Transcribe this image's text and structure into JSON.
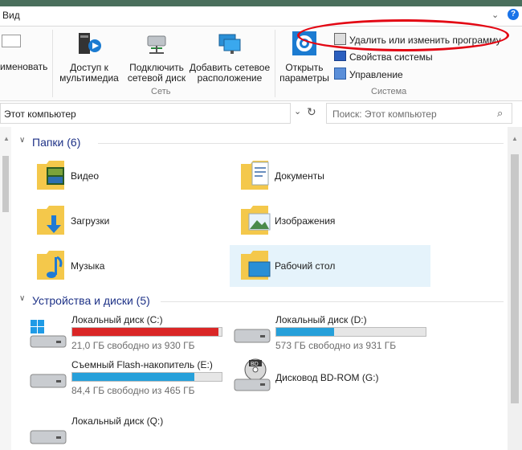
{
  "tabs": {
    "view": "Вид"
  },
  "ribbon": {
    "rename_fragment": "именовать",
    "media_access": "Доступ к\nмультимедиа",
    "map_drive": "Подключить\nсетевой диск",
    "add_location": "Добавить сетевое\nрасположение",
    "open_settings": "Открыть\nпараметры",
    "uninstall": "Удалить или изменить программу",
    "system_props": "Свойства системы",
    "manage": "Управление",
    "group_network": "Сеть",
    "group_system": "Система"
  },
  "address": {
    "path": "Этот компьютер",
    "search_placeholder": "Поиск: Этот компьютер"
  },
  "folders": {
    "header": "Папки (6)",
    "items": [
      "Видео",
      "Документы",
      "Загрузки",
      "Изображения",
      "Музыка",
      "Рабочий стол"
    ]
  },
  "devices": {
    "header": "Устройства и диски (5)",
    "items": [
      {
        "name": "Локальный диск (C:)",
        "free": "21,0 ГБ свободно из 930 ГБ",
        "used_fraction": 0.977,
        "color": "#da2626"
      },
      {
        "name": "Локальный диск (D:)",
        "free": "573 ГБ свободно из 931 ГБ",
        "used_fraction": 0.385,
        "color": "#26a0da"
      },
      {
        "name": "Съемный Flash-накопитель (E:)",
        "free": "84,4 ГБ свободно из 465 ГБ",
        "used_fraction": 0.818,
        "color": "#26a0da"
      },
      {
        "name": "Дисковод BD-ROM (G:)",
        "free": "",
        "used_fraction": null,
        "color": ""
      },
      {
        "name": "Локальный диск (Q:)",
        "free": "",
        "used_fraction": null,
        "color": ""
      }
    ]
  },
  "colors": {
    "highlight": "#e5f3fb",
    "annotation_red": "#e30613",
    "accent": "#1e3287"
  }
}
